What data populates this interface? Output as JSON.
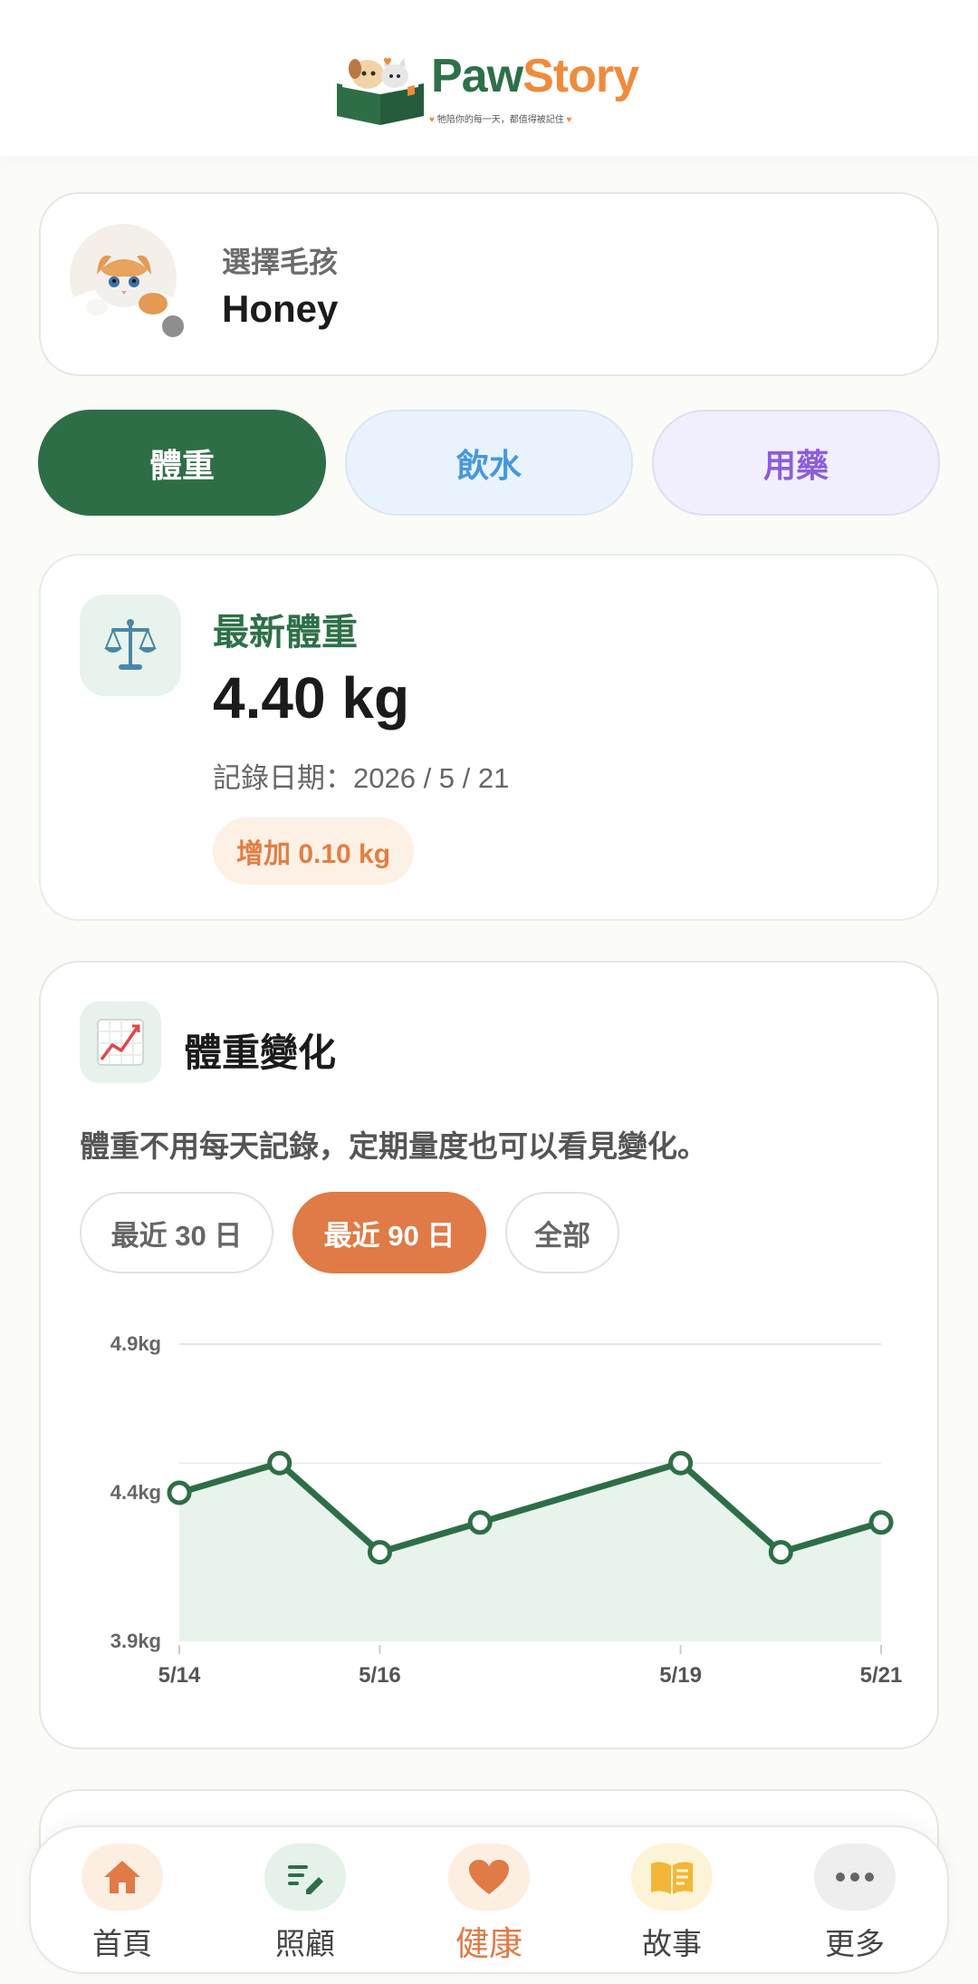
{
  "header": {
    "brand_part1": "Paw",
    "brand_part2": "Story",
    "tagline": "牠陪你的每一天，都值得被記住"
  },
  "pet_selector": {
    "label": "選擇毛孩",
    "pet_name": "Honey"
  },
  "tabs": [
    {
      "label": "體重",
      "active": true
    },
    {
      "label": "飲水",
      "active": false
    },
    {
      "label": "用藥",
      "active": false
    }
  ],
  "latest": {
    "label": "最新體重",
    "value": "4.40 kg",
    "record_date": "記錄日期：2026 / 5 / 21",
    "change": "增加 0.10 kg"
  },
  "weight_chart": {
    "title": "體重變化",
    "description": "體重不用每天記錄，定期量度也可以看見變化。",
    "ranges": [
      {
        "label": "最近 30 日",
        "active": false
      },
      {
        "label": "最近 90 日",
        "active": true
      },
      {
        "label": "全部",
        "active": false
      }
    ]
  },
  "chart_data": {
    "type": "area",
    "x": [
      "5/14",
      "5/15",
      "5/16",
      "5/17",
      "5/19",
      "5/20",
      "5/21"
    ],
    "values": [
      4.4,
      4.5,
      4.2,
      4.3,
      4.5,
      4.2,
      4.3
    ],
    "y_ticks": [
      "4.9kg",
      "4.4kg",
      "3.9kg"
    ],
    "x_tick_labels": [
      "5/14",
      "5/16",
      "5/19",
      "5/21"
    ],
    "ylim": [
      3.9,
      4.9
    ],
    "grid": true,
    "line_color": "#2e6e47",
    "fill_color": "#e8f3ec"
  },
  "bottom_nav": [
    {
      "label": "首頁",
      "icon": "home-icon",
      "active": false
    },
    {
      "label": "照顧",
      "icon": "care-edit-icon",
      "active": false
    },
    {
      "label": "健康",
      "icon": "heart-icon",
      "active": true
    },
    {
      "label": "故事",
      "icon": "book-icon",
      "active": false
    },
    {
      "label": "更多",
      "icon": "more-icon",
      "active": false
    }
  ],
  "colors": {
    "brand_green": "#2e6e47",
    "accent_orange": "#e07a46",
    "water_blue": "#4798dd",
    "med_purple": "#8c5ed8"
  }
}
